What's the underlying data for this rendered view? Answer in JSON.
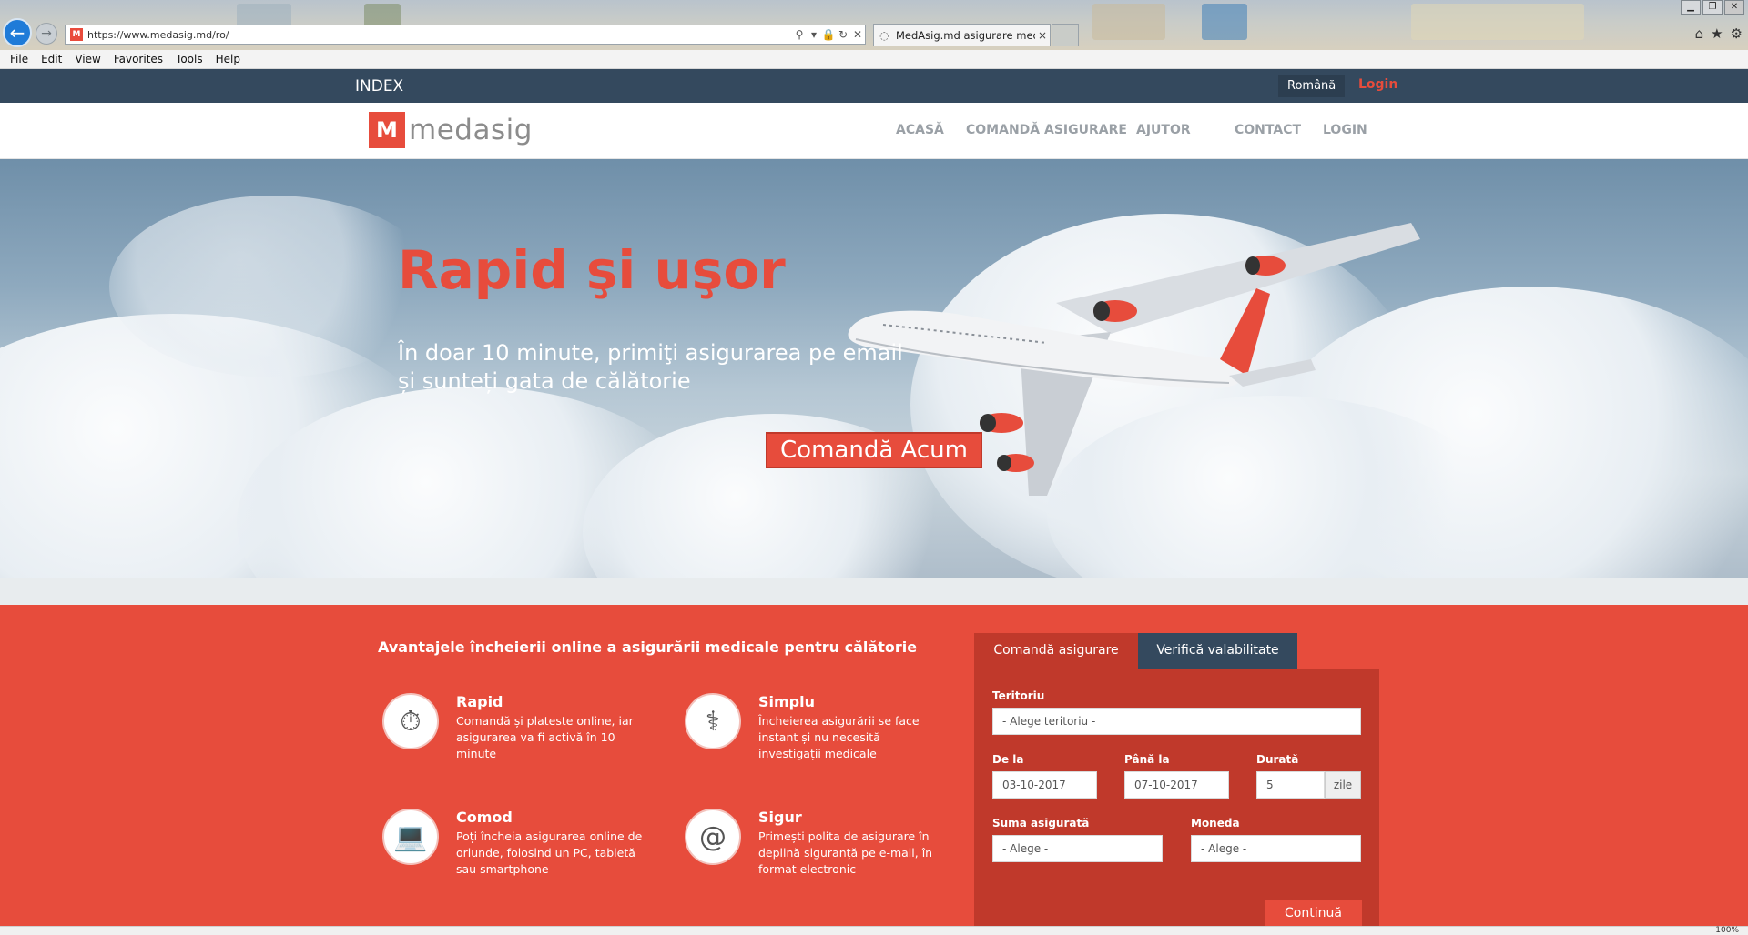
{
  "browser": {
    "url": "https://www.medasig.md/ro/",
    "tab_title": "MedAsig.md asigurare med...",
    "menu": [
      "File",
      "Edit",
      "View",
      "Favorites",
      "Tools",
      "Help"
    ],
    "zoom": "100%"
  },
  "topbar": {
    "index": "INDEX",
    "language": "Română",
    "login": "Login"
  },
  "header": {
    "logo_text": "medasig",
    "nav": [
      "ACASĂ",
      "COMANDĂ ASIGURARE",
      "AJUTOR",
      "CONTACT",
      "LOGIN"
    ]
  },
  "hero": {
    "title": "Rapid şi uşor",
    "subtitle_line1": "În doar 10 minute, primiţi asigurarea pe email",
    "subtitle_line2": "și sunteți gata de călătorie",
    "cta": "Comandă Acum"
  },
  "advantages": {
    "title": "Avantajele încheierii online a asigurării medicale pentru călătorie",
    "items": [
      {
        "name": "Rapid",
        "desc": "Comandă și plateste online, iar asigurarea va fi activă în 10 minute",
        "icon": "stopwatch-icon"
      },
      {
        "name": "Simplu",
        "desc": "Încheierea asigurării se face instant și nu necesită investigații medicale",
        "icon": "doctor-icon"
      },
      {
        "name": "Comod",
        "desc": "Poți încheia asigurarea online de oriunde, folosind un PC, tabletă sau smartphone",
        "icon": "laptop-icon"
      },
      {
        "name": "Sigur",
        "desc": "Primești polita de asigurare în deplină siguranță pe e-mail, în format electronic",
        "icon": "email-icon"
      }
    ]
  },
  "form": {
    "tab_order": "Comandă asigurare",
    "tab_verify": "Verifică valabilitate",
    "territory_label": "Teritoriu",
    "territory_value": "- Alege teritoriu -",
    "from_label": "De la",
    "from_value": "03-10-2017",
    "to_label": "Până la",
    "to_value": "07-10-2017",
    "duration_label": "Durată",
    "duration_value": "5",
    "duration_unit": "zile",
    "sum_label": "Suma asigurată",
    "sum_value": "- Alege -",
    "currency_label": "Moneda",
    "currency_value": "- Alege -",
    "continue": "Continuă"
  },
  "colors": {
    "brand_red": "#e74c3c",
    "dark_red": "#c0392b",
    "navy": "#34495e"
  }
}
